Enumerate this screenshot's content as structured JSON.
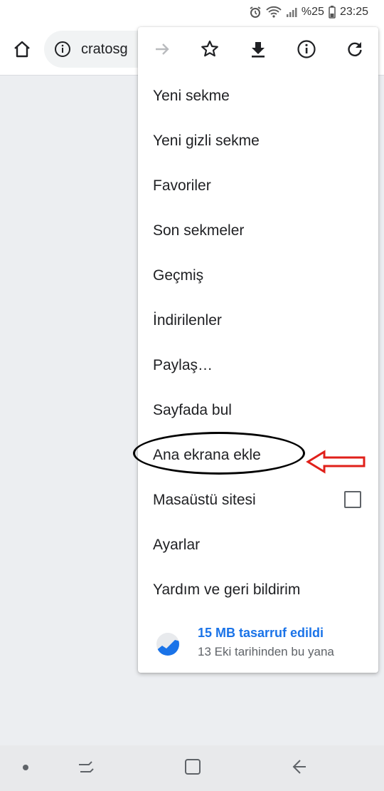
{
  "status_bar": {
    "battery_percent": "%25",
    "time": "23:25",
    "icons": [
      "alarm-icon",
      "wifi-icon",
      "signal-icon",
      "battery-icon"
    ]
  },
  "toolbar": {
    "url_text": "cratosg",
    "icons": [
      "home-icon",
      "site-info-icon"
    ]
  },
  "menu": {
    "action_icons": [
      "forward-icon",
      "star-icon",
      "download-icon",
      "info-icon",
      "refresh-icon"
    ],
    "items": [
      {
        "label": "Yeni sekme"
      },
      {
        "label": "Yeni gizli sekme"
      },
      {
        "label": "Favoriler"
      },
      {
        "label": "Son sekmeler"
      },
      {
        "label": "Geçmiş"
      },
      {
        "label": "İndirilenler"
      },
      {
        "label": "Paylaş…"
      },
      {
        "label": "Sayfada bul"
      },
      {
        "label": "Ana ekrana ekle"
      },
      {
        "label": "Masaüstü sitesi",
        "checked": false
      },
      {
        "label": "Ayarlar"
      },
      {
        "label": "Yardım ve geri bildirim"
      }
    ],
    "savings": {
      "title": "15 MB tasarruf edildi",
      "subtitle": "13 Eki tarihinden bu yana",
      "icon": "data-saver-chart-icon"
    }
  },
  "annotation": {
    "highlight_color": "#000000",
    "arrow_color": "#e0201a"
  },
  "nav_bar": {
    "icons": [
      "dot-icon",
      "recent-apps-icon",
      "home-square-icon",
      "back-icon"
    ]
  },
  "colors": {
    "accent": "#1a73e8",
    "page_background": "#eceef1"
  }
}
